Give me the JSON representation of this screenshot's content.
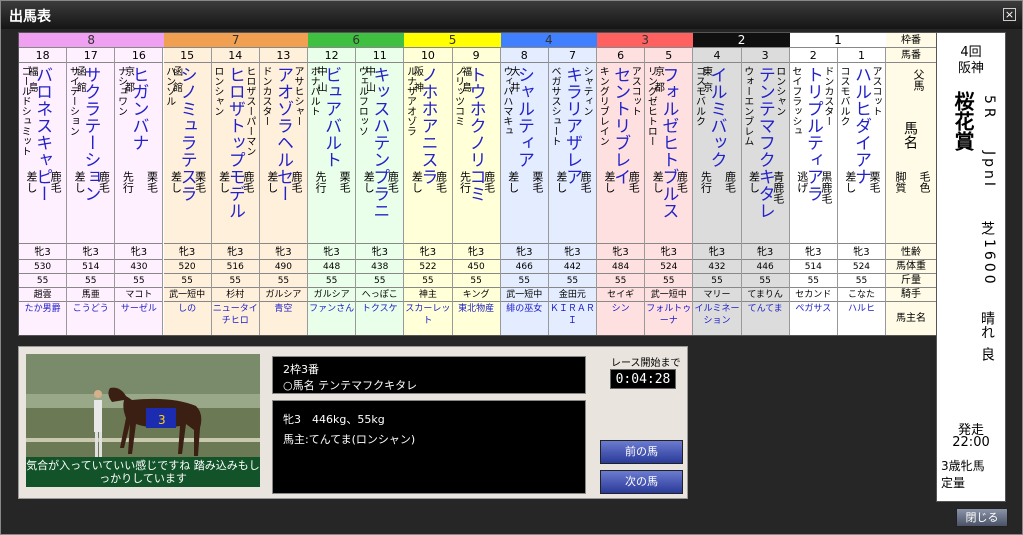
{
  "window": {
    "title": "出馬表",
    "close_icon": "×"
  },
  "labels": {
    "waku": "枠番",
    "umaban": "馬番",
    "sire": "父馬",
    "name": "馬名",
    "style": "脚質",
    "coat": "毛色",
    "sexage": "性齢",
    "weight": "馬体重",
    "kinryo": "斤量",
    "jockey": "騎手",
    "owner": "馬主名"
  },
  "waku_colors": {
    "8": "#f0a0f0",
    "7": "#f0a050",
    "6": "#40c040",
    "5": "#ffff00",
    "4": "#4080ff",
    "3": "#ff6060",
    "2": "#101010",
    "1": "#ffffff"
  },
  "col_bg": {
    "8": "#fff0ff",
    "7": "#fff0dc",
    "6": "#eaffea",
    "5": "#ffffd8",
    "4": "#e4ecff",
    "3": "#ffe0e0",
    "2": "#dcdcdc",
    "1": "#ffffff"
  },
  "horses": [
    {
      "waku": "8",
      "num": "18",
      "affil": "福島",
      "sire": "ゴールドシュミット",
      "name": "バロネスキャピー",
      "dam": "",
      "style": "差し",
      "coat": "鹿毛",
      "sexage": "牝3",
      "weight": "530",
      "kinryo": "55",
      "jockey": "趙雲",
      "owner": "たか男爵"
    },
    {
      "waku": "8",
      "num": "17",
      "affil": "函館",
      "sire": "サイテーション",
      "name": "サクラテーション",
      "dam": "",
      "style": "差し",
      "coat": "鹿毛",
      "sexage": "牝3",
      "weight": "514",
      "kinryo": "55",
      "jockey": "馬亜",
      "owner": "こうどう"
    },
    {
      "waku": "8",
      "num": "16",
      "affil": "京都",
      "sire": "ナシュワン",
      "name": "ヒガンバナ",
      "dam": "",
      "style": "先行",
      "coat": "栗毛",
      "sexage": "牝3",
      "weight": "430",
      "kinryo": "55",
      "jockey": "マコト",
      "owner": "サーゼル"
    },
    {
      "waku": "7",
      "num": "15",
      "affil": "函館",
      "sire": "ハンソル",
      "name": "シノミュラテスラ",
      "dam": "",
      "style": "差し",
      "coat": "栗毛",
      "sexage": "牝3",
      "weight": "520",
      "kinryo": "55",
      "jockey": "武一短中",
      "owner": "しの"
    },
    {
      "waku": "7",
      "num": "14",
      "affil": "",
      "sire": "ロンシャン",
      "name": "ヒロザトップモデル",
      "dam": "ヒロザスーパーマン",
      "style": "差し",
      "coat": "鹿毛",
      "sexage": "牝3",
      "weight": "516",
      "kinryo": "55",
      "jockey": "杉村",
      "owner": "ニュータイチヒロ"
    },
    {
      "waku": "7",
      "num": "13",
      "affil": "",
      "sire": "ドンカスター",
      "name": "アオゾラヘルセー",
      "dam": "アサヒシャー",
      "style": "差し",
      "coat": "鹿毛",
      "sexage": "牝3",
      "weight": "490",
      "kinryo": "55",
      "jockey": "ガルシア",
      "owner": "青空"
    },
    {
      "waku": "6",
      "num": "12",
      "affil": "中山",
      "sire": "ボナパルト",
      "name": "ビュアバルト",
      "dam": "",
      "style": "先行",
      "coat": "栗毛",
      "sexage": "牝3",
      "weight": "448",
      "kinryo": "55",
      "jockey": "ガルシア",
      "owner": "ファンさん"
    },
    {
      "waku": "6",
      "num": "11",
      "affil": "中山",
      "sire": "ヴェルフロッソ",
      "name": "キッスハテンプラニ",
      "dam": "",
      "style": "差し",
      "coat": "鹿毛",
      "sexage": "牝3",
      "weight": "438",
      "kinryo": "55",
      "jockey": "へっぽこ",
      "owner": "トクスケ"
    },
    {
      "waku": "5",
      "num": "10",
      "affil": "阪神",
      "sire": "ルナサアオゾラ",
      "name": "ノホホアニスラ",
      "dam": "",
      "style": "差し",
      "coat": "鹿毛",
      "sexage": "牝3",
      "weight": "522",
      "kinryo": "55",
      "jockey": "神主",
      "owner": "スカーレット"
    },
    {
      "waku": "5",
      "num": "9",
      "affil": "福島",
      "sire": "ノリッツコミ",
      "name": "トウホクノリコミ",
      "dam": "",
      "style": "先行",
      "coat": "鹿毛",
      "sexage": "牝3",
      "weight": "450",
      "kinryo": "55",
      "jockey": "キング",
      "owner": "東北物産"
    },
    {
      "waku": "4",
      "num": "8",
      "affil": "大井",
      "sire": "ウィバハマキュ",
      "name": "シャルティア",
      "dam": "",
      "style": "差し",
      "coat": "栗毛",
      "sexage": "牝3",
      "weight": "466",
      "kinryo": "55",
      "jockey": "武一短中",
      "owner": "緋の巫女"
    },
    {
      "waku": "4",
      "num": "7",
      "affil": "",
      "sire": "ベガサスシュート",
      "name": "キラリアザレア",
      "dam": "シャティン",
      "style": "差し",
      "coat": "鹿毛",
      "sexage": "牝3",
      "weight": "442",
      "kinryo": "55",
      "jockey": "金田元",
      "owner": "ＫＩＲＡＲＩ"
    },
    {
      "waku": "3",
      "num": "6",
      "affil": "",
      "sire": "キングリブレイン",
      "name": "セントリブレイ",
      "dam": "アスコット",
      "style": "差し",
      "coat": "鹿毛",
      "sexage": "牝3",
      "weight": "484",
      "kinryo": "55",
      "jockey": "セイギ",
      "owner": "シン"
    },
    {
      "waku": "3",
      "num": "5",
      "affil": "京都",
      "sire": "リングゼヒトロー",
      "name": "フォルゼヒトブルス",
      "dam": "",
      "style": "差し",
      "coat": "鹿毛",
      "sexage": "牝3",
      "weight": "524",
      "kinryo": "55",
      "jockey": "武一短中",
      "owner": "フォルトゥーナ"
    },
    {
      "waku": "2",
      "num": "4",
      "affil": "東京",
      "sire": "コスモバルク",
      "name": "イルミバック",
      "dam": "",
      "style": "先行",
      "coat": "鹿毛",
      "sexage": "牝3",
      "weight": "432",
      "kinryo": "55",
      "jockey": "マリー",
      "owner": "イルミネーション"
    },
    {
      "waku": "2",
      "num": "3",
      "affil": "",
      "sire": "ウォーエンブレム",
      "name": "テンテマフクキタレ",
      "dam": "ロンシャン",
      "style": "差し",
      "coat": "青鹿毛",
      "sexage": "牝3",
      "weight": "446",
      "kinryo": "55",
      "jockey": "てまりん",
      "owner": "てんてま"
    },
    {
      "waku": "1",
      "num": "2",
      "affil": "",
      "sire": "セイフラッシュ",
      "name": "トリプルティアラ",
      "dam": "ドンカスター",
      "style": "逃げ",
      "coat": "黒鹿毛",
      "sexage": "牝3",
      "weight": "514",
      "kinryo": "55",
      "jockey": "セカンド",
      "owner": "ペガサス"
    },
    {
      "waku": "1",
      "num": "1",
      "affil": "",
      "sire": "コスモバルク",
      "name": "ハルヒダイアナ",
      "dam": "アスコット",
      "style": "差し",
      "coat": "栗毛",
      "sexage": "牝3",
      "weight": "524",
      "kinryo": "55",
      "jockey": "こなた",
      "owner": "ハルヒ"
    }
  ],
  "race": {
    "meeting": "4回",
    "venue": "阪神",
    "name": "桜花賞",
    "race_no": "5R",
    "grade": "JpnI",
    "surface": "芝",
    "distance": "1600",
    "weather": "晴れ",
    "going": "良",
    "start_label": "発走",
    "start_time": "22:00",
    "conditions": "3歳牝馬 定量"
  },
  "selected": {
    "line1": "2枠3番",
    "line2": "○馬名 テンテマフクキタレ",
    "line3": "牝3　446kg、55kg",
    "line4": "馬主:てんてま(ロンシャン)",
    "comment": "気合が入っていていい感じですね 踏み込みもしっかりしています",
    "saddle_number": "3"
  },
  "timer": {
    "label": "レース開始まで",
    "value": "0:04:28"
  },
  "buttons": {
    "prev": "前の馬",
    "next": "次の馬",
    "close": "閉じる"
  }
}
